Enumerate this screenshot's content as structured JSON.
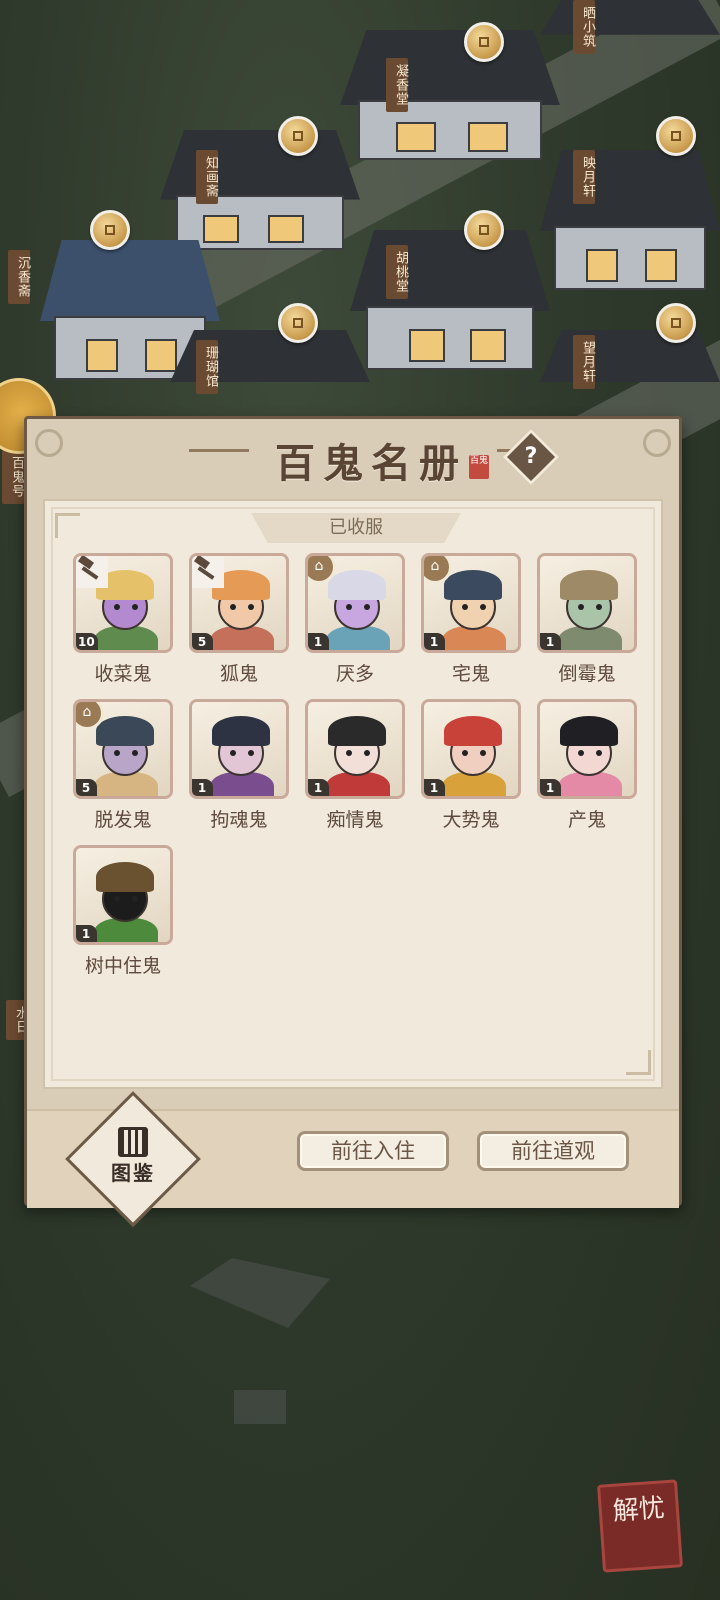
{
  "map": {
    "signs": [
      "晒小筑",
      "凝香堂",
      "知画斋",
      "映月轩",
      "沉香斋",
      "胡桃堂",
      "珊瑚馆",
      "望月轩",
      "百鬼号",
      "水日"
    ]
  },
  "dialog": {
    "title": "百鬼名册",
    "seal_text": "百鬼",
    "help_icon": "question-mark",
    "section_label": "已收服",
    "ghosts": [
      {
        "name": "收菜鬼",
        "level": "10",
        "badge": "hammer-icon",
        "palette": [
          "#e5c16a",
          "#b38ad0",
          "#5f8b4f"
        ]
      },
      {
        "name": "狐鬼",
        "level": "5",
        "badge": "hammer-icon",
        "palette": [
          "#e59a55",
          "#f1c9a8",
          "#c4705a"
        ]
      },
      {
        "name": "厌多",
        "level": "1",
        "badge": "temple-icon",
        "palette": [
          "#d8d8e6",
          "#c8a6e0",
          "#6aa3b8"
        ]
      },
      {
        "name": "宅鬼",
        "level": "1",
        "badge": "temple-icon",
        "palette": [
          "#3b4a5e",
          "#f0d2b0",
          "#d98754"
        ]
      },
      {
        "name": "倒霉鬼",
        "level": "1",
        "badge": "",
        "palette": [
          "#9f8a67",
          "#a9c4a8",
          "#7f8b6e"
        ]
      },
      {
        "name": "脱发鬼",
        "level": "5",
        "badge": "temple-icon",
        "palette": [
          "#3a4858",
          "#b8a5c8",
          "#d6b582"
        ]
      },
      {
        "name": "拘魂鬼",
        "level": "1",
        "badge": "",
        "palette": [
          "#2e3344",
          "#e3c6d6",
          "#7a4d8f"
        ]
      },
      {
        "name": "痴情鬼",
        "level": "1",
        "badge": "",
        "palette": [
          "#2a2a2a",
          "#f2e0d8",
          "#c03a3a"
        ]
      },
      {
        "name": "大势鬼",
        "level": "1",
        "badge": "",
        "palette": [
          "#c8423a",
          "#f0cfc0",
          "#d9a13a"
        ]
      },
      {
        "name": "产鬼",
        "level": "1",
        "badge": "",
        "palette": [
          "#1f1f24",
          "#f2d7d3",
          "#e58aa6"
        ]
      },
      {
        "name": "树中住鬼",
        "level": "1",
        "badge": "",
        "palette": [
          "#6a5230",
          "#1c1c1c",
          "#4e8a3c"
        ]
      }
    ],
    "codex_label": "图鉴",
    "buttons": {
      "move_in": "前往入住",
      "temple": "前往道观"
    }
  },
  "corner_logo": "解忧"
}
